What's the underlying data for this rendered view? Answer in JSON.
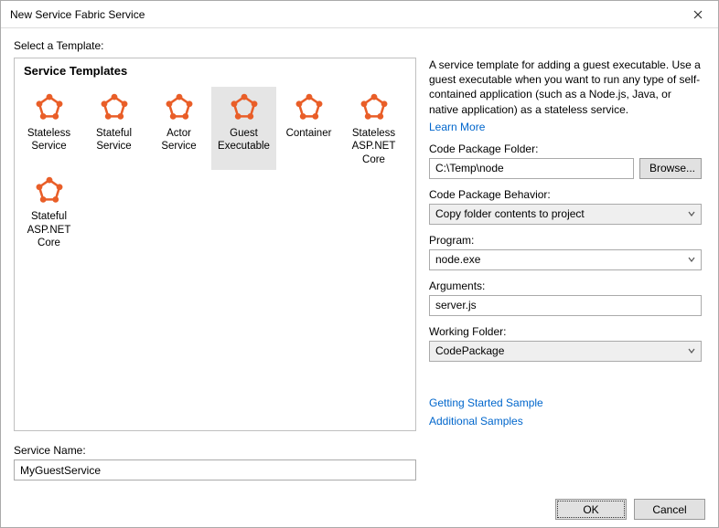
{
  "window": {
    "title": "New Service Fabric Service"
  },
  "main": {
    "select_template_label": "Select a Template:",
    "templates_header": "Service Templates",
    "templates": [
      {
        "label": "Stateless Service",
        "selected": false
      },
      {
        "label": "Stateful Service",
        "selected": false
      },
      {
        "label": "Actor Service",
        "selected": false
      },
      {
        "label": "Guest Executable",
        "selected": true
      },
      {
        "label": "Container",
        "selected": false
      },
      {
        "label": "Stateless ASP.NET Core",
        "selected": false
      },
      {
        "label": "Stateful ASP.NET Core",
        "selected": false
      }
    ],
    "service_name_label": "Service Name:",
    "service_name_value": "MyGuestService"
  },
  "right": {
    "description": "A service template for adding a guest executable. Use a guest executable when you want to run any type of self-contained application (such as a Node.js, Java, or native application) as a stateless service.",
    "learn_more": "Learn More",
    "code_package_folder_label": "Code Package Folder:",
    "code_package_folder_value": "C:\\Temp\\node",
    "browse_label": "Browse...",
    "code_package_behavior_label": "Code Package Behavior:",
    "code_package_behavior_value": "Copy folder contents to project",
    "program_label": "Program:",
    "program_value": "node.exe",
    "arguments_label": "Arguments:",
    "arguments_value": "server.js",
    "working_folder_label": "Working Folder:",
    "working_folder_value": "CodePackage",
    "getting_started_link": "Getting Started Sample",
    "additional_samples_link": "Additional Samples"
  },
  "footer": {
    "ok": "OK",
    "cancel": "Cancel"
  },
  "colors": {
    "accent": "#e95e28",
    "link": "#0066cc"
  }
}
